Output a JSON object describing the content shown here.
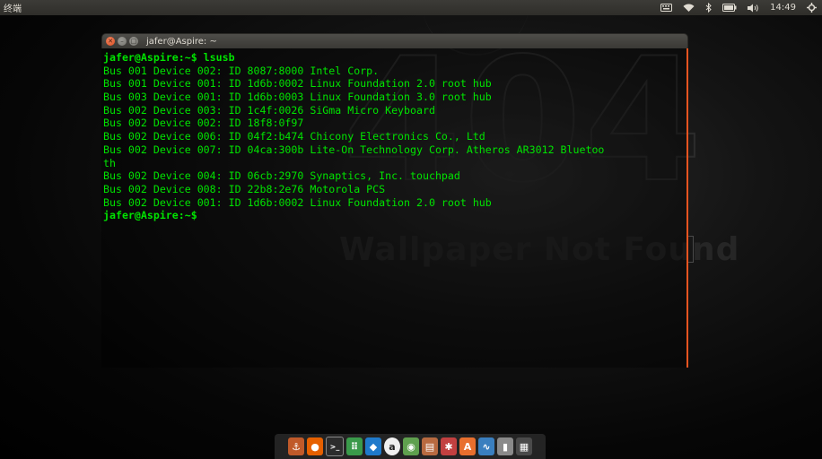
{
  "top_panel": {
    "app_title": "终端",
    "clock": "14:49",
    "indicators": [
      "keyboard-icon",
      "wifi-icon",
      "bluetooth-icon",
      "battery-icon",
      "volume-icon",
      "gear-icon"
    ]
  },
  "wallpaper": {
    "big_text": "404",
    "caption": "Wallpaper Not Found"
  },
  "terminal": {
    "title": "jafer@Aspire: ~",
    "lines": [
      "jafer@Aspire:~$ lsusb",
      "Bus 001 Device 002: ID 8087:8000 Intel Corp.",
      "Bus 001 Device 001: ID 1d6b:0002 Linux Foundation 2.0 root hub",
      "Bus 003 Device 001: ID 1d6b:0003 Linux Foundation 3.0 root hub",
      "Bus 002 Device 003: ID 1c4f:0026 SiGma Micro Keyboard",
      "Bus 002 Device 002: ID 18f8:0f97",
      "Bus 002 Device 006: ID 04f2:b474 Chicony Electronics Co., Ltd",
      "Bus 002 Device 007: ID 04ca:300b Lite-On Technology Corp. Atheros AR3012 Bluetoo",
      "th",
      "Bus 002 Device 004: ID 06cb:2970 Synaptics, Inc. touchpad",
      "Bus 002 Device 008: ID 22b8:2e76 Motorola PCS",
      "Bus 002 Device 001: ID 1d6b:0002 Linux Foundation 2.0 root hub",
      "jafer@Aspire:~$"
    ]
  },
  "dock": {
    "items": [
      {
        "name": "anchor-icon",
        "color": "#c05a2a"
      },
      {
        "name": "firefox-icon",
        "color": "#e66000"
      },
      {
        "name": "terminal-icon",
        "color": "#2c2c2c"
      },
      {
        "name": "app-grid-icon",
        "color": "#3a9a4a"
      },
      {
        "name": "vscode-icon",
        "color": "#1f7acb"
      },
      {
        "name": "amazon-icon",
        "color": "#f0f0f0"
      },
      {
        "name": "android-studio-icon",
        "color": "#5fa04e"
      },
      {
        "name": "files-icon",
        "color": "#b86a40"
      },
      {
        "name": "settings-icon",
        "color": "#c24040"
      },
      {
        "name": "software-center-icon",
        "color": "#e86f2e"
      },
      {
        "name": "system-monitor-icon",
        "color": "#3a7fbf"
      },
      {
        "name": "trash-icon",
        "color": "#8a8a8a"
      },
      {
        "name": "workspace-icon",
        "color": "#4a4a4a"
      }
    ]
  }
}
